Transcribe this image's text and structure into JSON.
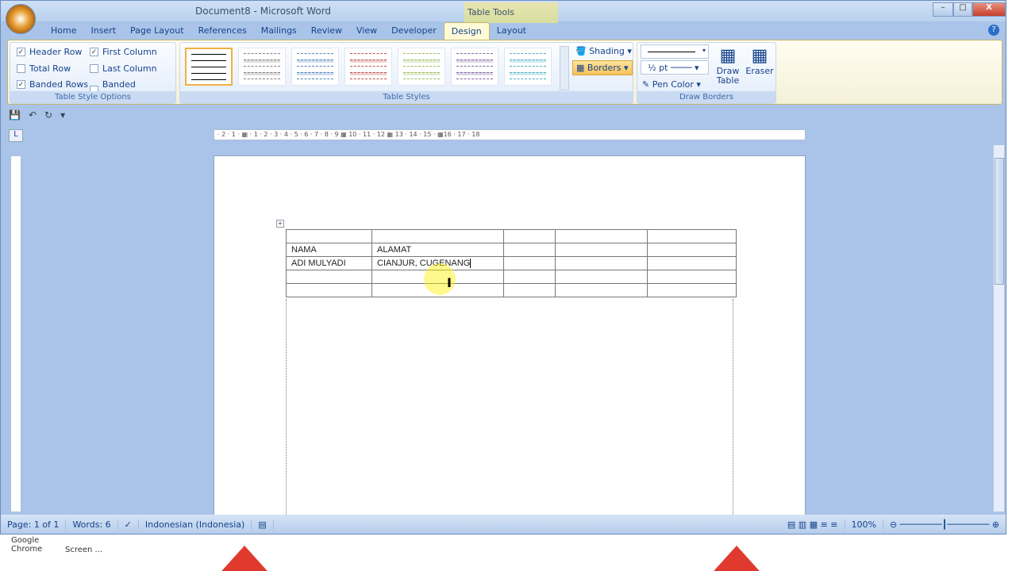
{
  "window": {
    "title": "Document8 - Microsoft Word",
    "context_tab": "Table Tools",
    "minimize": "–",
    "maximize": "□",
    "close": "X",
    "help": "?"
  },
  "tabs": [
    {
      "label": "Home"
    },
    {
      "label": "Insert"
    },
    {
      "label": "Page Layout"
    },
    {
      "label": "References"
    },
    {
      "label": "Mailings"
    },
    {
      "label": "Review"
    },
    {
      "label": "View"
    },
    {
      "label": "Developer"
    },
    {
      "label": "Design",
      "active": true
    },
    {
      "label": "Layout"
    }
  ],
  "ribbon": {
    "table_style_options": {
      "label": "Table Style Options",
      "options": [
        {
          "label": "Header Row",
          "checked": true
        },
        {
          "label": "First Column",
          "checked": true
        },
        {
          "label": "Total Row",
          "checked": false
        },
        {
          "label": "Last Column",
          "checked": false
        },
        {
          "label": "Banded Rows",
          "checked": true
        },
        {
          "label": "Banded Columns",
          "checked": false
        }
      ]
    },
    "table_styles": {
      "label": "Table Styles",
      "swatch_colors": [
        "#333333",
        "#7f7f7f",
        "#4f81bd",
        "#c0504d",
        "#9bbb59",
        "#8064a2",
        "#4bacc6"
      ],
      "shading": "Shading",
      "borders": "Borders"
    },
    "draw_borders": {
      "label": "Draw Borders",
      "line_weight": "½ pt",
      "pen_color": "Pen Color",
      "draw_table": "Draw Table",
      "eraser": "Eraser"
    }
  },
  "ruler": "· 2 · 1 · ▦ · 1 · 2 · 3 · 4 · 5 · 6 · 7 · 8 · 9 ▦ 10 · 11 · 12 ▦ 13 · 14 · 15 · ▦16 · 17 · 18",
  "table": {
    "rows": [
      [
        "",
        "",
        "",
        "",
        ""
      ],
      [
        "NAMA",
        "ALAMAT",
        "",
        "",
        ""
      ],
      [
        "ADI MULYADI",
        "CIANJUR, CUGENANG",
        "",
        "",
        ""
      ],
      [
        "",
        "",
        "",
        "",
        ""
      ],
      [
        "",
        "",
        "",
        "",
        ""
      ]
    ]
  },
  "status": {
    "page": "Page: 1 of 1",
    "words": "Words: 6",
    "language": "Indonesian (Indonesia)",
    "zoom": "100%"
  },
  "desktop": {
    "icons": [
      {
        "label": "Google Chrome"
      },
      {
        "label": "Screen ..."
      }
    ]
  }
}
